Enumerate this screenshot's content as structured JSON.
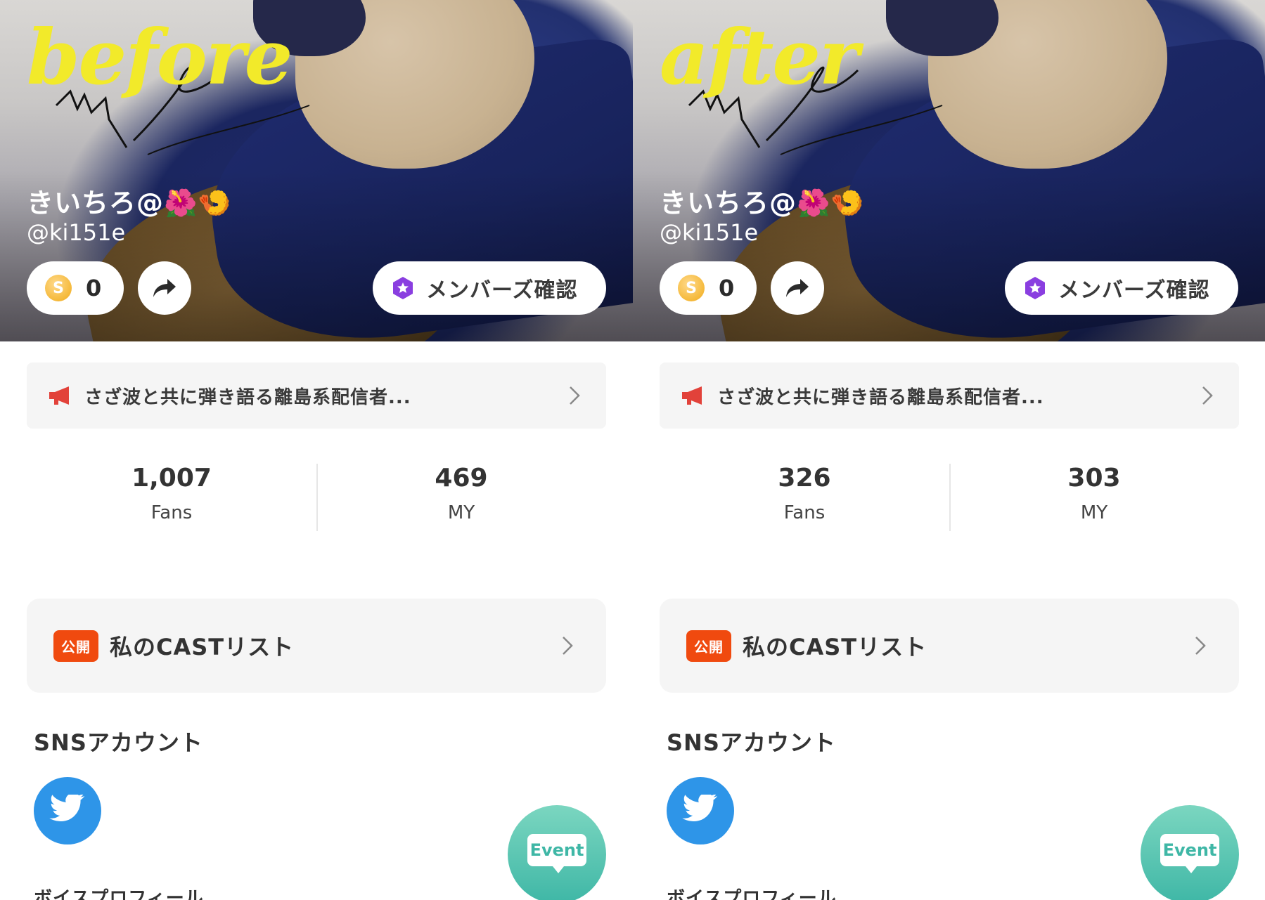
{
  "panels": [
    {
      "overlay_word": "before",
      "display_name": "きいちろ@🌺🍤",
      "handle": "@ki151e",
      "coin_count": "0",
      "coin_symbol": "S",
      "members_label": "メンバーズ確認",
      "announcement": "さざ波と共に弾き語る離島系配信者...",
      "stats": {
        "fans_value": "1,007",
        "fans_label": "Fans",
        "my_value": "469",
        "my_label": "MY"
      },
      "cast_badge": "公開",
      "cast_title": "私のCASTリスト",
      "sns_heading": "SNSアカウント",
      "voice_heading": "ボイスプロフィール",
      "event_label": "Event"
    },
    {
      "overlay_word": "after",
      "display_name": "きいちろ@🌺🍤",
      "handle": "@ki151e",
      "coin_count": "0",
      "coin_symbol": "S",
      "members_label": "メンバーズ確認",
      "announcement": "さざ波と共に弾き語る離島系配信者...",
      "stats": {
        "fans_value": "326",
        "fans_label": "Fans",
        "my_value": "303",
        "my_label": "MY"
      },
      "cast_badge": "公開",
      "cast_title": "私のCASTリスト",
      "sns_heading": "SNSアカウント",
      "voice_heading": "ボイスプロフィール",
      "event_label": "Event"
    }
  ],
  "icons": {
    "coin": "coin-icon",
    "share": "share-icon",
    "members_badge": "members-badge-icon",
    "megaphone": "megaphone-icon",
    "chevron": "chevron-right-icon",
    "twitter": "twitter-icon",
    "event": "event-icon"
  },
  "colors": {
    "overlay_word": "#f2ea2a",
    "public_badge": "#f04a0f",
    "members_badge": "#8a3ee0",
    "megaphone": "#e2423a",
    "twitter": "#2e95e8",
    "event_start": "#7bd6c0",
    "event_end": "#3fb7a6"
  }
}
